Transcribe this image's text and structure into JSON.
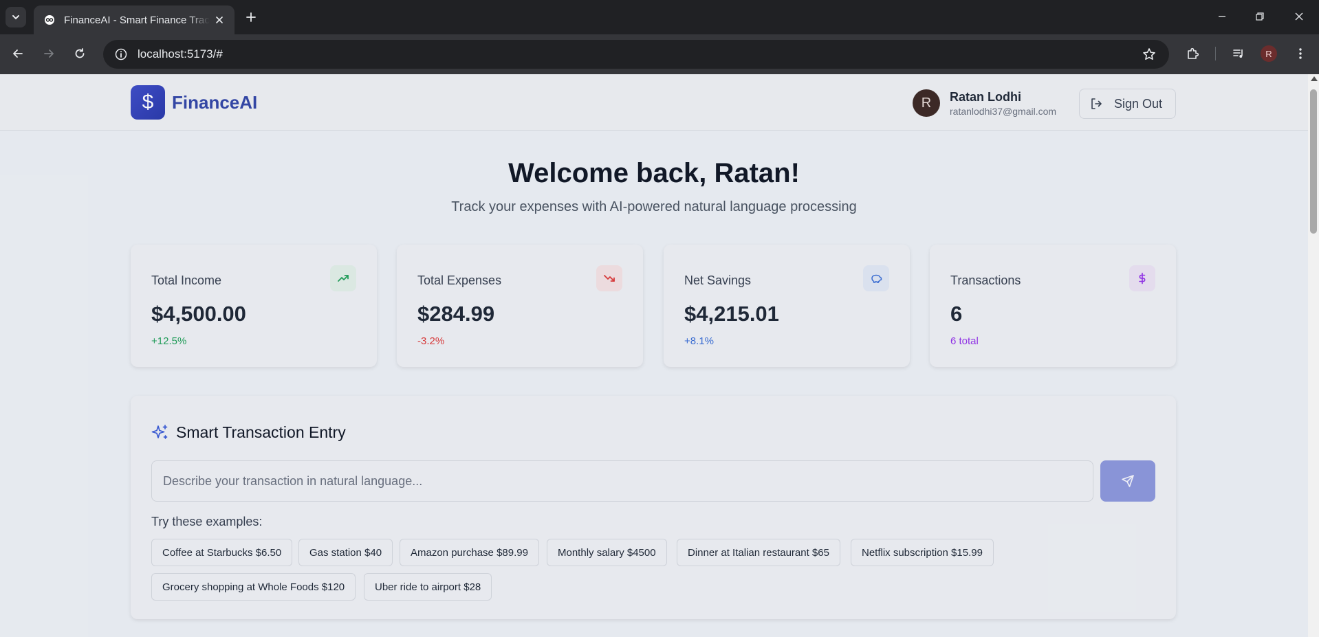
{
  "browser": {
    "tab_title": "FinanceAI - Smart Finance Tracker",
    "url": "localhost:5173/#",
    "profile_initial": "R"
  },
  "app": {
    "logo_symbol": "$",
    "logo_text": "FinanceAI",
    "user": {
      "initial": "R",
      "name": "Ratan Lodhi",
      "email": "ratanlodhi37@gmail.com"
    },
    "sign_out_label": "Sign Out",
    "welcome": "Welcome back, Ratan!",
    "subtitle": "Track your expenses with AI-powered natural language processing",
    "stats": [
      {
        "label": "Total Income",
        "value": "$4,500.00",
        "change": "+12.5%",
        "icon": "trending-up-icon",
        "accent": "#22a05a",
        "icon_bg": "#e2efe8"
      },
      {
        "label": "Total Expenses",
        "value": "$284.99",
        "change": "-3.2%",
        "icon": "trending-down-icon",
        "accent": "#dc3b3b",
        "icon_bg": "#f3e2e4"
      },
      {
        "label": "Net Savings",
        "value": "$4,215.01",
        "change": "+8.1%",
        "icon": "piggy-bank-icon",
        "accent": "#3b6fd6",
        "icon_bg": "#e1e8f4"
      },
      {
        "label": "Transactions",
        "value": "6",
        "change": "6 total",
        "icon": "dollar-icon",
        "accent": "#9333ea",
        "icon_bg": "#ebe3f3"
      }
    ],
    "entry": {
      "title": "Smart Transaction Entry",
      "placeholder": "Describe your transaction in natural language...",
      "examples_label": "Try these examples:",
      "examples": [
        "Coffee at Starbucks $6.50",
        "Gas station $40",
        "Amazon purchase $89.99",
        "Monthly salary $4500",
        "Dinner at Italian restaurant $65",
        "Netflix subscription $15.99",
        "Grocery shopping at Whole Foods $120",
        "Uber ride to airport $28"
      ]
    }
  }
}
